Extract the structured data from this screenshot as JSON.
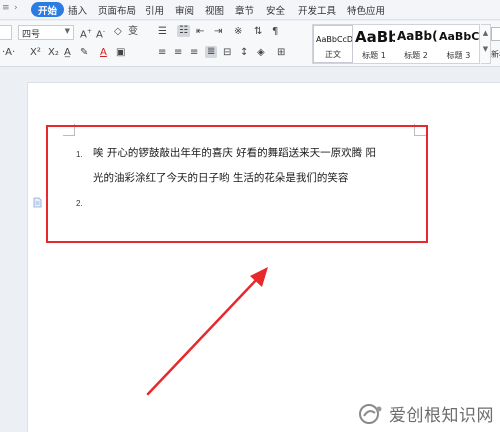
{
  "menubar": {
    "quick_access": [
      "≡",
      "›",
      "⌕",
      "↶",
      "↷",
      "⌄"
    ],
    "tabs": [
      "开始",
      "插入",
      "页面布局",
      "引用",
      "审阅",
      "视图",
      "章节",
      "安全",
      "开发工具",
      "特色应用"
    ],
    "active_tab": "开始"
  },
  "ribbon": {
    "font_size_value": "四号",
    "styles": [
      {
        "sample": "AaBbCcDd",
        "caption": "正文"
      },
      {
        "sample": "AaBb",
        "caption": "标题 1"
      },
      {
        "sample": "AaBb(",
        "caption": "标题 2"
      },
      {
        "sample": "AaBbC",
        "caption": "标题 3"
      }
    ],
    "new_style_caption": "新样"
  },
  "document": {
    "items": [
      {
        "number": "1.",
        "lines": [
          "唉  开心的锣鼓敲出年年的喜庆  好看的舞蹈送来天一原欢腾  阳",
          "光的油彩涂红了今天的日子哟  生活的花朵是我们的笑容"
        ]
      },
      {
        "number": "2.",
        "lines": [
          ""
        ]
      }
    ]
  },
  "annotation": {
    "box_color": "#e8282b",
    "arrow_color": "#e8282b"
  },
  "watermark": {
    "text": "爱创根知识网"
  },
  "colors": {
    "accent": "#2b7be3",
    "ribbon_bg": "#f7f8fa",
    "workspace_bg": "#eceff3"
  }
}
